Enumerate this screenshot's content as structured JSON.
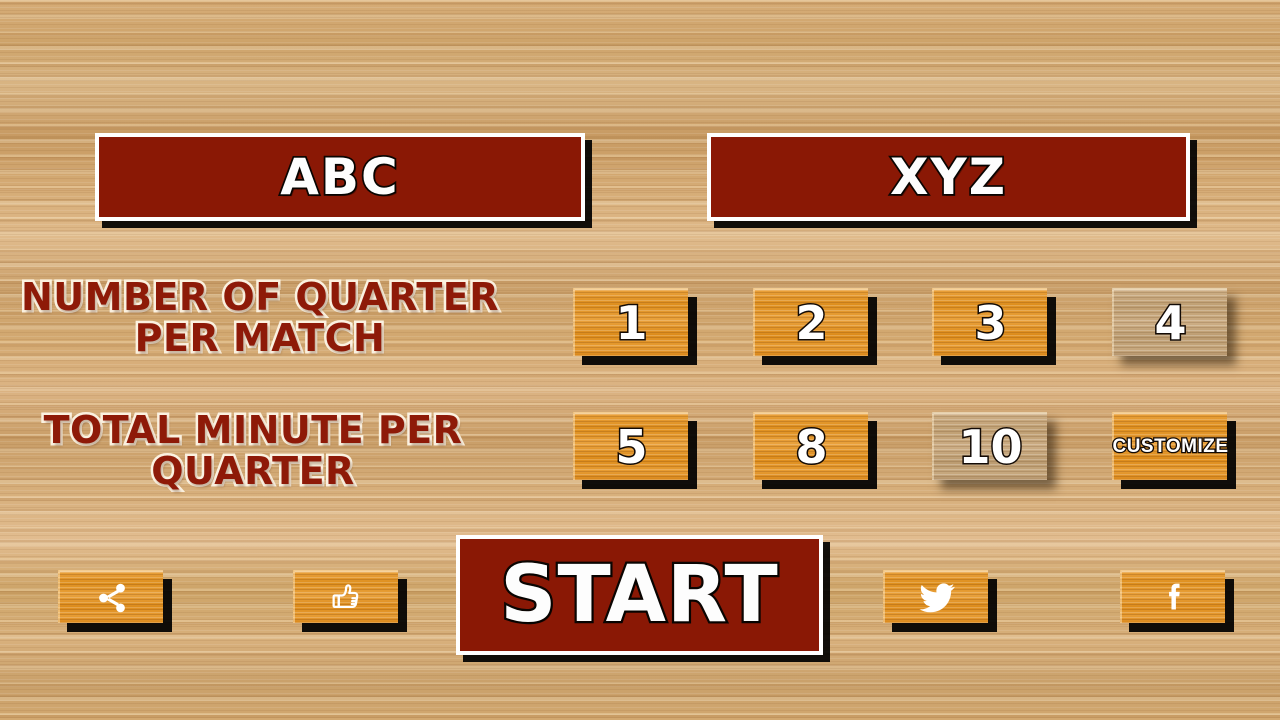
{
  "theme": {
    "wood_light": "#d4a96a",
    "wood_button": "#e39423",
    "wood_selected": "#c3a47b",
    "banner_red": "#8a1805",
    "text_white": "#ffffff",
    "outline_dark": "#120a05",
    "label_outline": "#fbf1e0"
  },
  "teams": {
    "home": {
      "name": "ABC"
    },
    "away": {
      "name": "XYZ"
    }
  },
  "settings": {
    "quarters": {
      "label": "NUMBER OF QUARTER PER MATCH",
      "options": [
        {
          "value": "1",
          "selected": false
        },
        {
          "value": "2",
          "selected": false
        },
        {
          "value": "3",
          "selected": false
        },
        {
          "value": "4",
          "selected": true
        }
      ],
      "selected_value": "4"
    },
    "minutes": {
      "label": "TOTAL MINUTE PER QUARTER",
      "options": [
        {
          "value": "5",
          "selected": false
        },
        {
          "value": "8",
          "selected": false
        },
        {
          "value": "10",
          "selected": true
        },
        {
          "value": "CUSTOMIZE",
          "selected": false
        }
      ],
      "selected_value": "10"
    }
  },
  "actions": {
    "start": "START"
  },
  "social": [
    {
      "name": "share",
      "icon": "share-icon"
    },
    {
      "name": "like",
      "icon": "thumbs-up-icon"
    },
    {
      "name": "twitter",
      "icon": "twitter-icon"
    },
    {
      "name": "facebook",
      "icon": "facebook-icon"
    }
  ]
}
